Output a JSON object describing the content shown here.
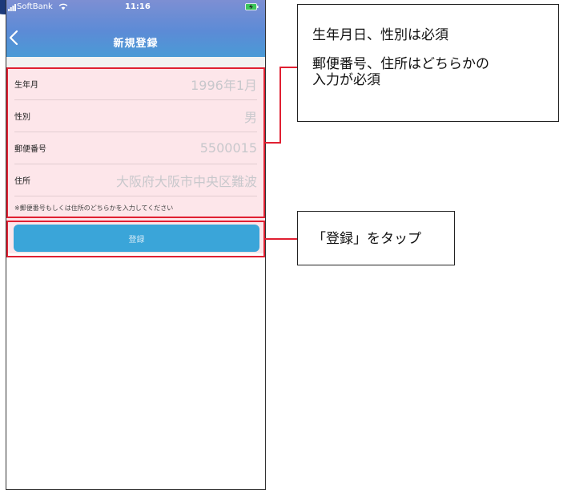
{
  "status_bar": {
    "carrier": "SoftBank",
    "time": "11:16"
  },
  "nav": {
    "title": "新規登録"
  },
  "form": {
    "rows": [
      {
        "label": "生年月",
        "value": "1996年1月"
      },
      {
        "label": "性別",
        "value": "男"
      },
      {
        "label": "郵便番号",
        "value": "5500015"
      },
      {
        "label": "住所",
        "value": "大阪府大阪市中央区難波"
      }
    ],
    "note": "※郵便番号もしくは住所のどちらかを入力してください",
    "submit_label": "登録"
  },
  "callouts": {
    "top_line1": "生年月日、性別は必須",
    "top_line2": "郵便番号、住所はどちらかの",
    "top_line3": "入力が必須",
    "button": "「登録」をタップ"
  },
  "colors": {
    "highlight": "#e02032",
    "button": "#3aa5d9",
    "form_tint": "#fde6ea"
  }
}
